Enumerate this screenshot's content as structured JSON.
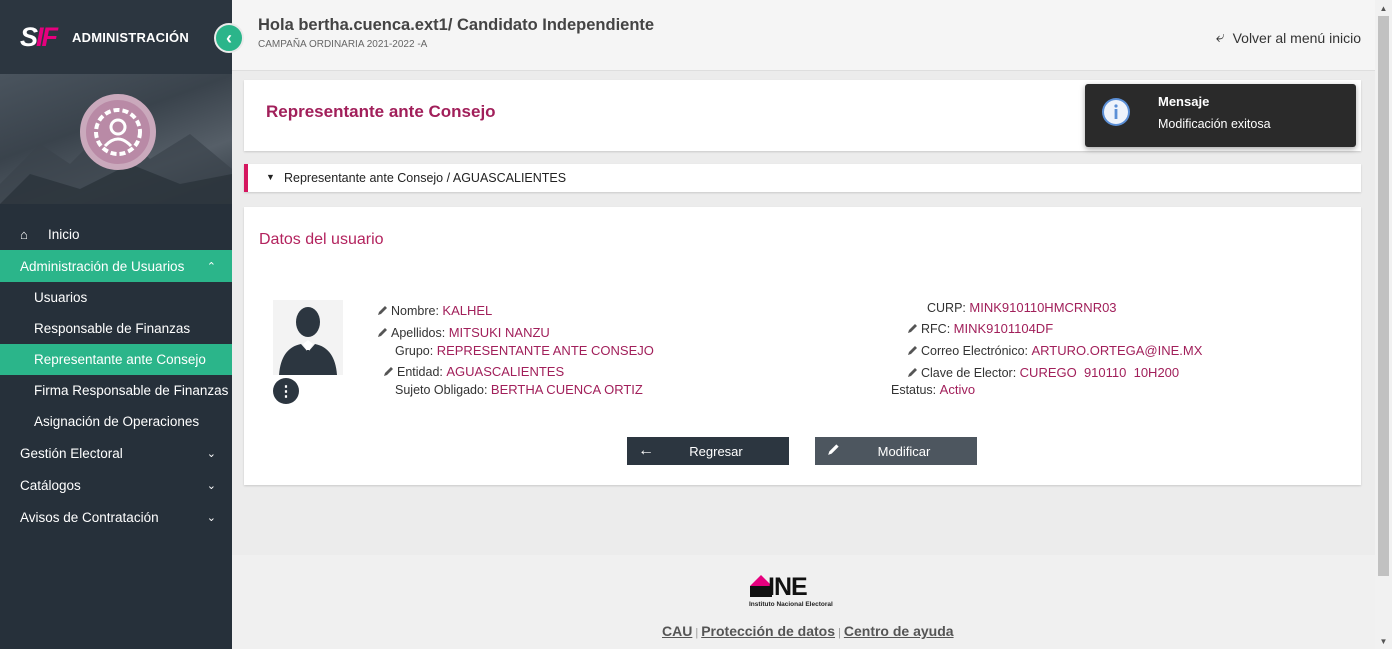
{
  "sidebar": {
    "logo_s": "S",
    "logo_if": "IF",
    "brand_title": "ADMINISTRACIÓN",
    "collapse_glyph": "‹",
    "nav": {
      "home": "Inicio",
      "admin_users": "Administración de Usuarios",
      "users": "Usuarios",
      "finance_resp": "Responsable de Finanzas",
      "council_rep": "Representante ante Consejo",
      "finance_sign": "Firma Responsable de Finanzas",
      "ops_assign": "Asignación de Operaciones",
      "electoral": "Gestión Electoral",
      "catalogs": "Catálogos",
      "contracts": "Avisos de Contratación"
    }
  },
  "header": {
    "greeting": "Hola bertha.cuenca.ext1/ Candidato Independiente",
    "campaign": "CAMPAÑA ORDINARIA 2021-2022 -A",
    "back_menu": "Volver al menú inicio"
  },
  "page": {
    "title": "Representante ante Consejo",
    "breadcrumb": "Representante ante Consejo / AGUASCALIENTES",
    "section_title": "Datos del usuario"
  },
  "user": {
    "nombre_label": "Nombre:",
    "nombre": "KALHEL",
    "apellidos_label": "Apellidos:",
    "apellidos": "MITSUKI NANZU",
    "grupo_label": "Grupo:",
    "grupo": "REPRESENTANTE ANTE CONSEJO",
    "entidad_label": "Entidad:",
    "entidad": "AGUASCALIENTES",
    "sujeto_label": "Sujeto Obligado:",
    "sujeto": "BERTHA CUENCA ORTIZ",
    "curp_label": "CURP:",
    "curp": "MINK910110HMCRNR03",
    "rfc_label": "RFC:",
    "rfc": "MINK9101104DF",
    "correo_label": "Correo Electrónico:",
    "correo": "ARTURO.ORTEGA@INE.MX",
    "clave_label": "Clave de Elector:",
    "clave": "CUREGO  910110  10H200",
    "estatus_label": "Estatus:",
    "estatus": "Activo"
  },
  "buttons": {
    "back": "Regresar",
    "edit": "Modificar"
  },
  "footer": {
    "ine": "INE",
    "ine_sub": "Instituto Nacional Electoral",
    "cau": "CAU",
    "privacy": "Protección de datos",
    "help": "Centro de ayuda",
    "sep": "|"
  },
  "toast": {
    "title": "Mensaje",
    "message": "Modificación exitosa"
  },
  "colors": {
    "accent": "#2bb58a",
    "brand_magenta": "#a11f5a",
    "sidebar_bg": "#26303a"
  }
}
